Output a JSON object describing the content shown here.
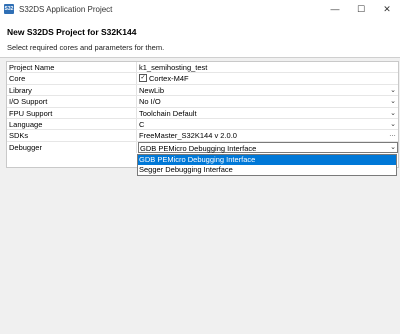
{
  "window": {
    "title": "S32DS Application Project",
    "icon": "S32",
    "minimize": "—",
    "maximize": "☐",
    "close": "✕"
  },
  "header": {
    "title": "New S32DS Project for S32K144",
    "subtitle": "Select required cores and parameters for them."
  },
  "rows": [
    {
      "label": "Project Name",
      "value": "k1_semihosting_test"
    },
    {
      "label": "Core",
      "value": "Cortex-M4F",
      "checked": true
    },
    {
      "label": "Library",
      "value": "NewLib"
    },
    {
      "label": "I/O Support",
      "value": "No I/O"
    },
    {
      "label": "FPU Support",
      "value": "Toolchain Default"
    },
    {
      "label": "Language",
      "value": "C"
    },
    {
      "label": "SDKs",
      "value": "FreeMaster_S32K144 v 2.0.0"
    },
    {
      "label": "Debugger",
      "value": "GDB PEMicro Debugging Interface"
    }
  ],
  "debugger_options": [
    "GDB PEMicro Debugging Interface",
    "Segger Debugging Interface"
  ],
  "selected_option_index": 0,
  "icons": {
    "check": "✓",
    "chevron": "⌄",
    "sdk_button": "…"
  }
}
